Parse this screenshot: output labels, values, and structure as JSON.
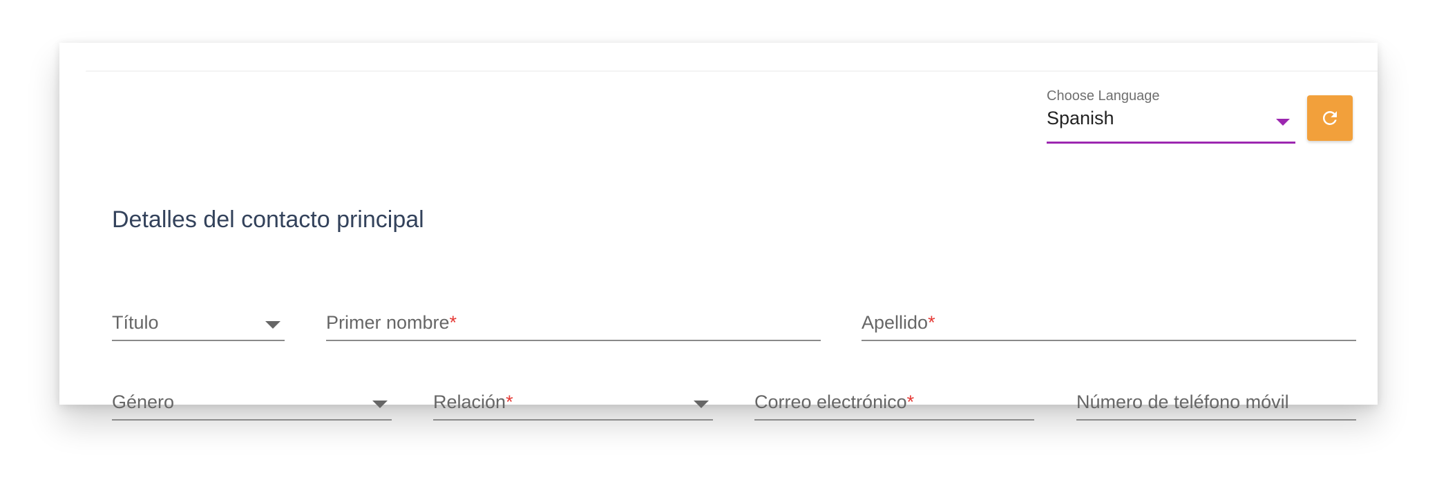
{
  "language_selector": {
    "label": "Choose Language",
    "value": "Spanish",
    "accent_color": "#9c27b0"
  },
  "refresh_button": {
    "icon": "refresh-icon",
    "color": "#f2a03b"
  },
  "section": {
    "title": "Detalles del contacto principal"
  },
  "fields": {
    "titulo": {
      "label": "Título",
      "required_mark": ""
    },
    "primer_nombre": {
      "label": "Primer nombre",
      "required_mark": "*"
    },
    "apellido": {
      "label": "Apellido",
      "required_mark": "*"
    },
    "genero": {
      "label": "Género",
      "required_mark": ""
    },
    "relacion": {
      "label": "Relación",
      "required_mark": "*"
    },
    "correo": {
      "label": "Correo electrónico",
      "required_mark": "*"
    },
    "telefono": {
      "label": "Número de teléfono móvil",
      "required_mark": ""
    }
  },
  "colors": {
    "required_mark": "#e53935",
    "title_text": "#33425b"
  }
}
